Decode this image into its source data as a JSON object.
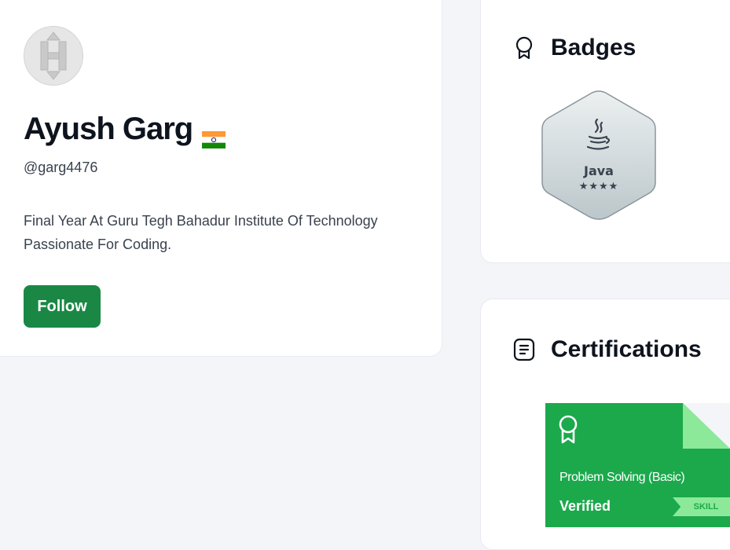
{
  "profile": {
    "name": "Ayush Garg",
    "handle": "@garg4476",
    "bio": "Final Year At Guru Tegh Bahadur Institute Of Technology Passionate For Coding.",
    "follow_label": "Follow",
    "flag_icon": "india-flag-icon",
    "avatar_letter": "H"
  },
  "badges": {
    "title": "Badges",
    "icon": "badge-icon",
    "items": [
      {
        "label": "Java",
        "stars": "★★★★",
        "star_count": 4,
        "icon": "java-cup-icon"
      }
    ]
  },
  "certifications": {
    "title": "Certifications",
    "icon": "document-icon",
    "items": [
      {
        "name": "Problem Solving (Basic)",
        "status": "Verified",
        "tag": "SKILL",
        "icon": "ribbon-icon"
      }
    ]
  },
  "colors": {
    "follow_button": "#1a8844",
    "cert_green": "#1ba94c",
    "cert_fold": "#8ce99a",
    "page_bg": "#f4f5f9"
  }
}
